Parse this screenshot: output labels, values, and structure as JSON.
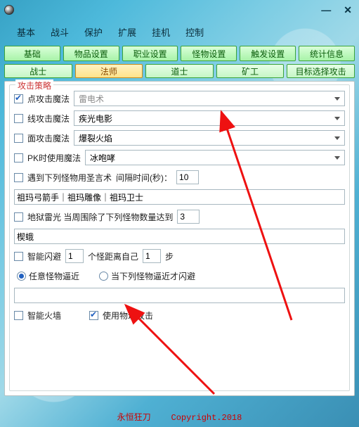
{
  "title": "",
  "controls": {
    "min": "—",
    "close": "✕"
  },
  "toptabs": [
    "基本",
    "战斗",
    "保护",
    "扩展",
    "挂机",
    "控制"
  ],
  "gbtns": [
    "基础",
    "物品设置",
    "职业设置",
    "怪物设置",
    "触发设置",
    "统计信息"
  ],
  "subtabs": [
    "战士",
    "法师",
    "道士",
    "矿工",
    "目标选择攻击"
  ],
  "selected_subtab": 1,
  "strategy_title": "攻击策略",
  "rows": {
    "point": {
      "label": "点攻击魔法",
      "combo": "雷电术"
    },
    "line": {
      "label": "线攻击魔法",
      "combo": "疾光电影"
    },
    "area": {
      "label": "面攻击魔法",
      "combo": "爆裂火焰"
    },
    "pk": {
      "label": "PK时使用魔法",
      "combo": "冰咆哮"
    },
    "holy": {
      "label": "遇到下列怪物用圣言术",
      "interval_lbl": "间隔时间(秒)：",
      "interval_val": "10"
    },
    "holy_list": "祖玛弓箭手｜祖玛雕像｜祖玛卫士",
    "hell": {
      "label": "地狱雷光 当周围除了下列怪物数量达到",
      "val": "3"
    },
    "hell_list": "楔蛾",
    "dodge": {
      "label": "智能闪避",
      "n1": "1",
      "mid": "个怪距离自己",
      "n2": "1",
      "suf": "步"
    },
    "radio": {
      "opt1": "任意怪物逼近",
      "opt2": "当下列怪物逼近才闪避"
    },
    "dodge_list": "",
    "firewall": {
      "label": "智能火墙"
    },
    "physical": {
      "label": "使用物理攻击"
    }
  },
  "footer": {
    "left": "永恒狂刀",
    "right": "Copyright.2018"
  }
}
